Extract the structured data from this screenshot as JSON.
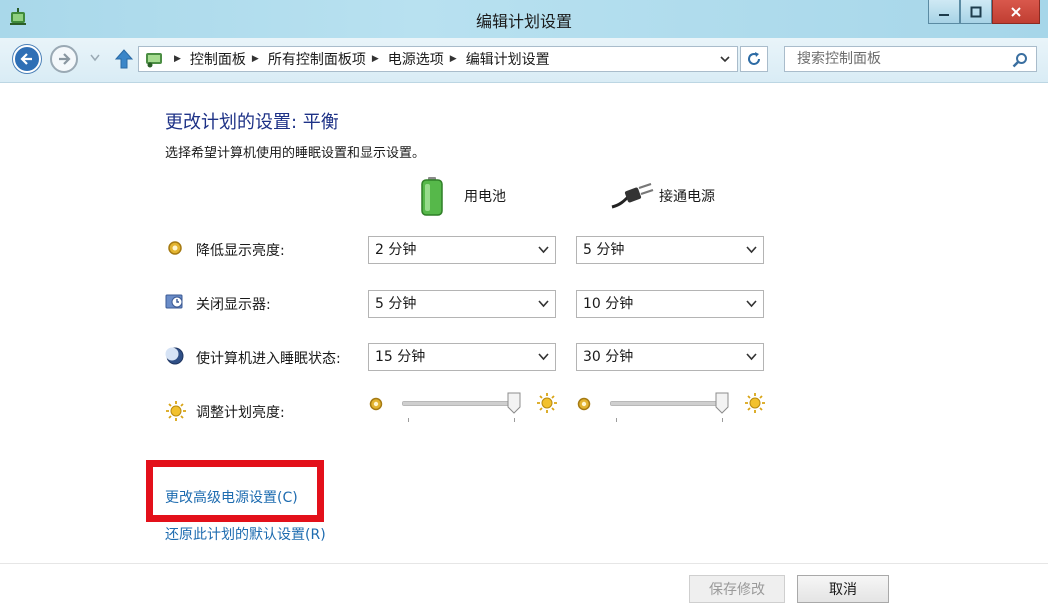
{
  "window": {
    "title": "编辑计划设置",
    "icons": {
      "app": "power-options-icon",
      "minimize": "minimize-icon",
      "maximize": "maximize-icon",
      "close": "close-icon"
    }
  },
  "nav": {
    "icons": {
      "back": "back-arrow-icon",
      "forward": "forward-arrow-icon",
      "history": "chevron-down-icon",
      "up": "up-arrow-icon",
      "refresh": "refresh-icon",
      "search": "search-icon"
    },
    "breadcrumbs": [
      "控制面板",
      "所有控制面板项",
      "电源选项",
      "编辑计划设置"
    ],
    "search_placeholder": "搜索控制面板"
  },
  "main": {
    "heading": "更改计划的设置: 平衡",
    "description": "选择希望计算机使用的睡眠设置和显示设置。",
    "columns": [
      {
        "label": "用电池",
        "icon": "battery-icon"
      },
      {
        "label": "接通电源",
        "icon": "power-plug-icon"
      }
    ],
    "rows": [
      {
        "label": "降低显示亮度:",
        "icon": "dim-display-icon",
        "battery": "2 分钟",
        "plugged": "5 分钟"
      },
      {
        "label": "关闭显示器:",
        "icon": "display-off-icon",
        "battery": "5 分钟",
        "plugged": "10 分钟"
      },
      {
        "label": "使计算机进入睡眠状态:",
        "icon": "sleep-moon-icon",
        "battery": "15 分钟",
        "plugged": "30 分钟"
      }
    ],
    "brightness": {
      "label": "调整计划亮度:",
      "icon": "brightness-sun-icon",
      "battery_level": 0.95,
      "plugged_level": 0.95
    },
    "links": {
      "advanced": "更改高级电源设置(C)",
      "restore": "还原此计划的默认设置(R)"
    }
  },
  "buttons": {
    "save": "保存修改",
    "cancel": "取消"
  },
  "colors": {
    "heading": "#1e3287",
    "link": "#1e6cb0",
    "highlight": "#e3101a",
    "titlebar": "#b8e1f0",
    "back_button": "#2f6fb5"
  }
}
